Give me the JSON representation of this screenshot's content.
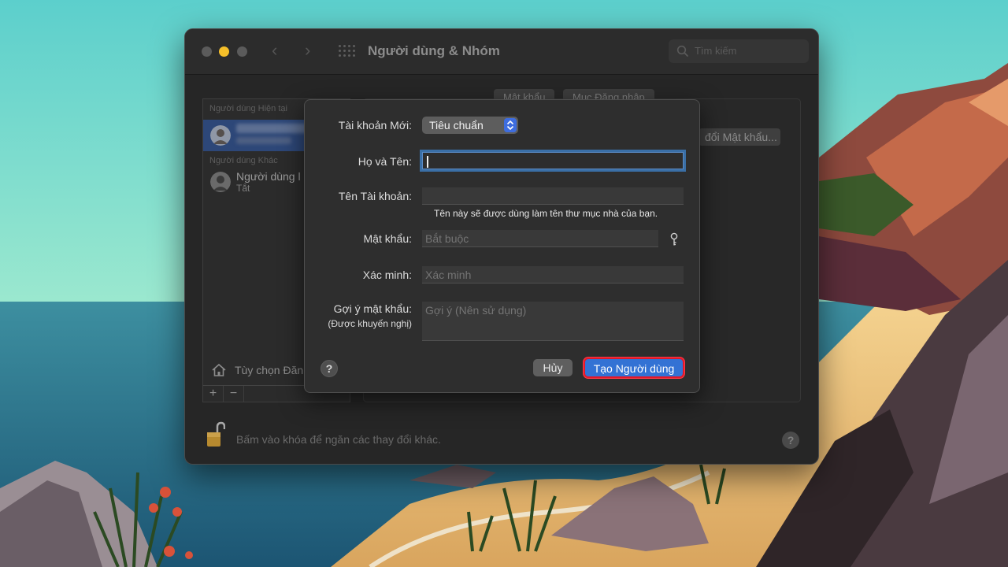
{
  "window": {
    "title": "Người dùng & Nhóm",
    "search_placeholder": "Tìm kiếm"
  },
  "sidebar": {
    "current_users_header": "Người dùng Hiện tại",
    "other_users_header": "Người dùng Khác",
    "other_user_name": "Người dùng l",
    "other_user_status": "Tắt",
    "login_options": "Tùy chọn Đăn",
    "add": "+",
    "remove": "−"
  },
  "panel": {
    "tab_password": "Mật khẩu",
    "tab_login_items": "Mục Đăng nhập",
    "change_password": "đổi Mật khẩu..."
  },
  "footer": {
    "lock_text": "Bấm vào khóa để ngăn các thay đổi khác.",
    "help": "?"
  },
  "sheet": {
    "account_type_label": "Tài khoản Mới:",
    "account_type_value": "Tiêu chuẩn",
    "full_name_label": "Họ và Tên:",
    "full_name_value": "",
    "account_name_label": "Tên Tài khoản:",
    "account_name_value": "",
    "account_name_hint": "Tên này sẽ được dùng làm tên thư mục nhà của bạn.",
    "password_label": "Mật khẩu:",
    "password_placeholder": "Bắt buộc",
    "verify_label": "Xác minh:",
    "verify_placeholder": "Xác minh",
    "hint_label": "Gợi ý mật khẩu:",
    "hint_sublabel": "(Được khuyến nghị)",
    "hint_placeholder": "Gợi ý (Nên sử dụng)",
    "help": "?",
    "cancel": "Hủy",
    "create": "Tạo Người dùng"
  },
  "colors": {
    "accent": "#3372d4",
    "highlight_border": "#e3182a",
    "window_bg": "#262626"
  }
}
